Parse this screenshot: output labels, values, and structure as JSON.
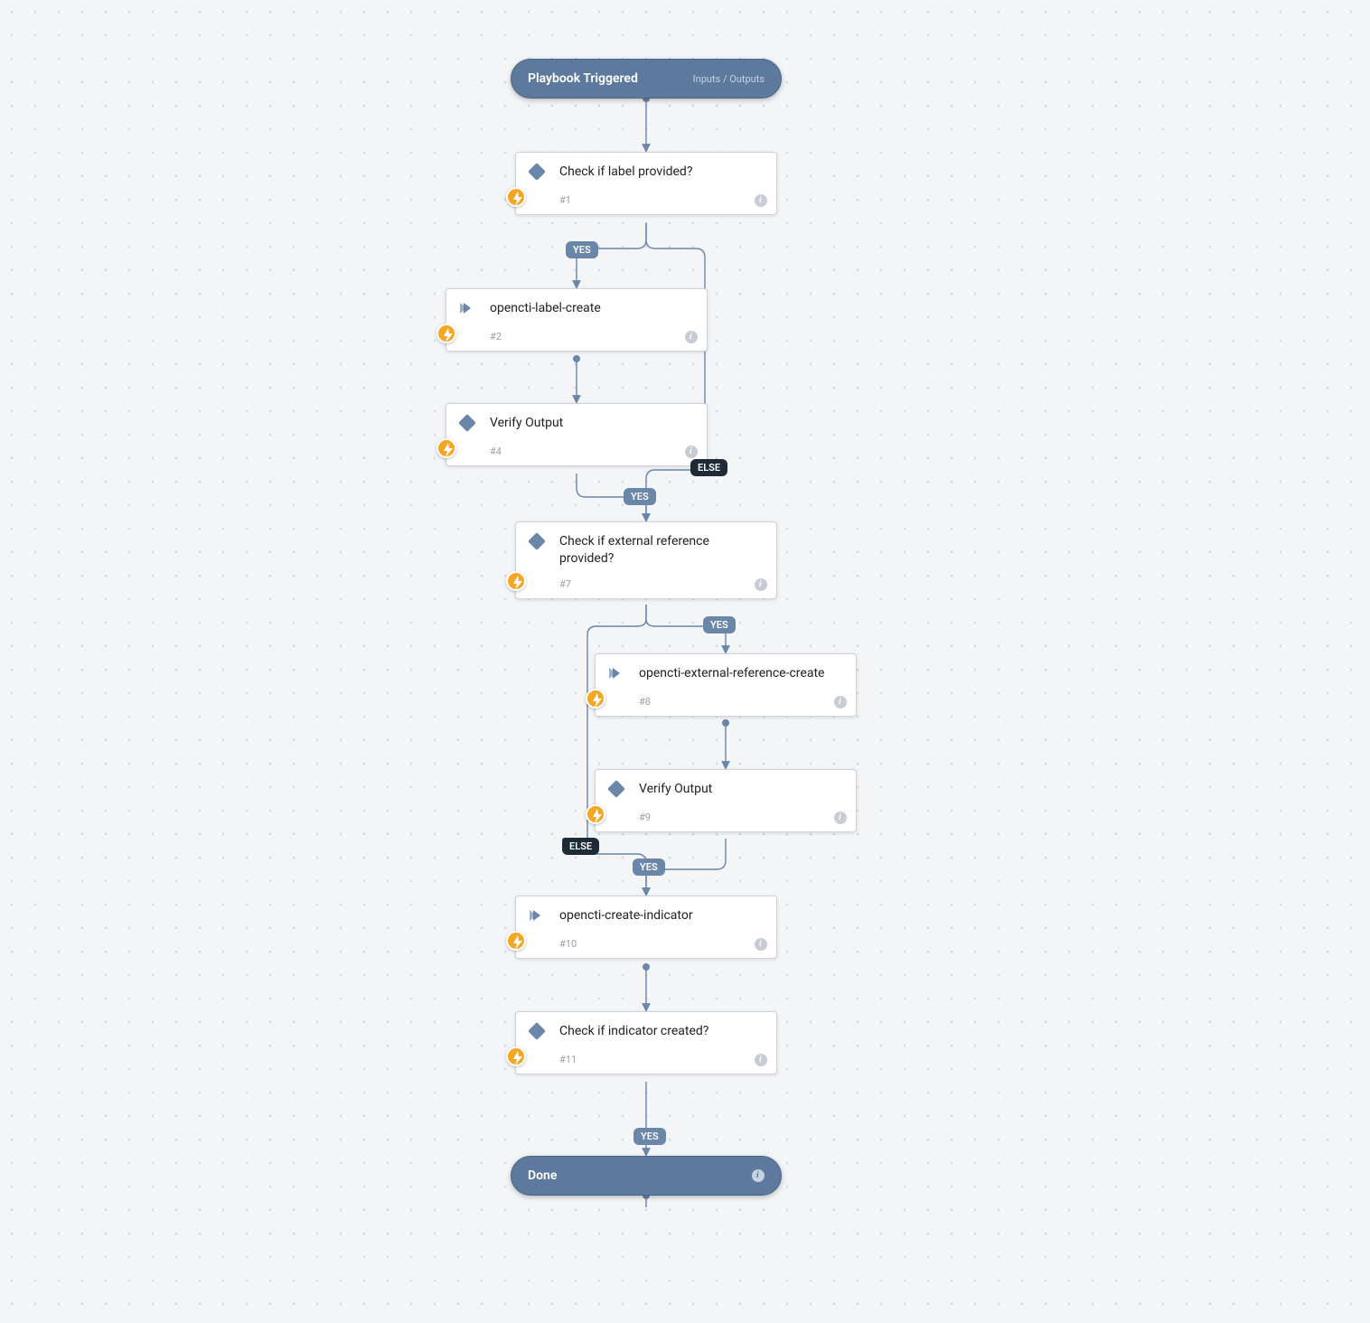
{
  "start": {
    "title": "Playbook Triggered",
    "io": "Inputs / Outputs"
  },
  "end": {
    "title": "Done"
  },
  "tasks": {
    "t1": {
      "title": "Check if label provided?",
      "num": "#1",
      "kind": "condition"
    },
    "t2": {
      "title": "opencti-label-create",
      "num": "#2",
      "kind": "action"
    },
    "t4": {
      "title": "Verify Output",
      "num": "#4",
      "kind": "condition"
    },
    "t7": {
      "title": "Check if external reference provided?",
      "num": "#7",
      "kind": "condition"
    },
    "t8": {
      "title": "opencti-external-reference-create",
      "num": "#8",
      "kind": "action"
    },
    "t9": {
      "title": "Verify Output",
      "num": "#9",
      "kind": "condition"
    },
    "t10": {
      "title": "opencti-create-indicator",
      "num": "#10",
      "kind": "action"
    },
    "t11": {
      "title": "Check if indicator created?",
      "num": "#11",
      "kind": "condition"
    }
  },
  "labels": {
    "yes1": "YES",
    "yes4": "YES",
    "else4": "ELSE",
    "yes7": "YES",
    "yes9": "YES",
    "else9": "ELSE",
    "yes11": "YES"
  }
}
